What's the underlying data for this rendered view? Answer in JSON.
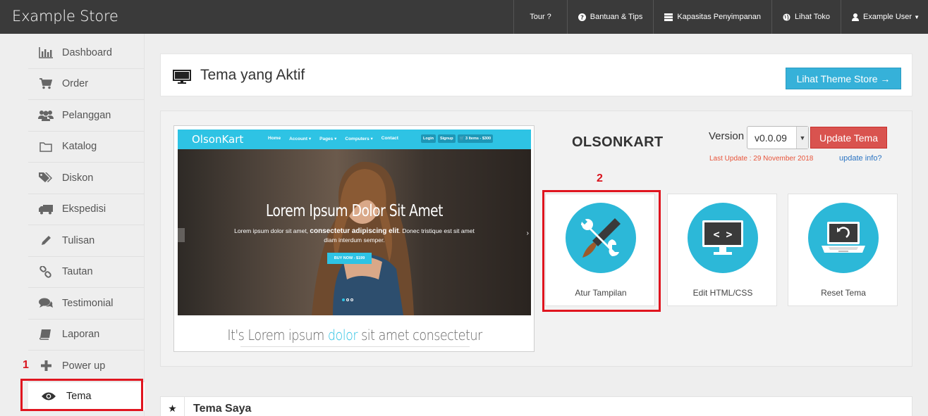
{
  "brand": "Example Store",
  "topnav": {
    "tour": "Tour ?",
    "help": "Bantuan & Tips",
    "storage": "Kapasitas Penyimpanan",
    "view_store": "Lihat Toko",
    "user": "Example User"
  },
  "sidebar": {
    "items": [
      {
        "label": "Dashboard",
        "icon": "bar-chart-icon"
      },
      {
        "label": "Order",
        "icon": "cart-icon"
      },
      {
        "label": "Pelanggan",
        "icon": "users-icon"
      },
      {
        "label": "Katalog",
        "icon": "folder-icon"
      },
      {
        "label": "Diskon",
        "icon": "tags-icon"
      },
      {
        "label": "Ekspedisi",
        "icon": "truck-icon"
      },
      {
        "label": "Tulisan",
        "icon": "pencil-icon"
      },
      {
        "label": "Tautan",
        "icon": "link-icon"
      },
      {
        "label": "Testimonial",
        "icon": "comments-icon"
      },
      {
        "label": "Laporan",
        "icon": "book-icon"
      },
      {
        "label": "Power up",
        "icon": "plus-icon"
      },
      {
        "label": "Tema",
        "icon": "eye-icon"
      }
    ],
    "active": "Tema"
  },
  "annotations": {
    "step1": "1",
    "step2": "2"
  },
  "header": {
    "title": "Tema yang Aktif",
    "theme_store_button": "Lihat Theme Store →"
  },
  "preview": {
    "logo": "OlsonKart",
    "menu": [
      "Home",
      "Account ▾",
      "Pages ▾",
      "Computers ▾",
      "Contact"
    ],
    "buttons": [
      "Login",
      "Signup",
      "🛒 3 Items - $300"
    ],
    "hero_title": "Lorem Ipsum Dolor Sit Amet",
    "hero_sub_1a": "Lorem ipsum dolor sit amet, ",
    "hero_sub_1b": "consectetur adipiscing elit",
    "hero_sub_1c": ". Donec tristique est sit amet",
    "hero_sub_2": "diam interdum semper.",
    "buy_button": "BUY NOW - $199",
    "tagline_a": "It's Lorem ipsum ",
    "tagline_b": "dolor",
    "tagline_c": " sit amet consectetur"
  },
  "theme": {
    "name": "OLSONKART",
    "version_label": "Version",
    "version_value": "v0.0.09",
    "update_button": "Update Tema",
    "last_update": "Last Update : 29 November 2018",
    "update_info": "update info?"
  },
  "tiles": [
    {
      "label": "Atur Tampilan",
      "icon": "wrench-brush-icon"
    },
    {
      "label": "Edit HTML/CSS",
      "icon": "monitor-code-icon"
    },
    {
      "label": "Reset Tema",
      "icon": "laptop-reset-icon"
    }
  ],
  "tema_saya": {
    "title": "Tema Saya"
  },
  "colors": {
    "topbar": "#3a3a3a",
    "accent": "#2cb8d8",
    "danger": "#d9534f",
    "highlight_box": "#e0151f"
  }
}
